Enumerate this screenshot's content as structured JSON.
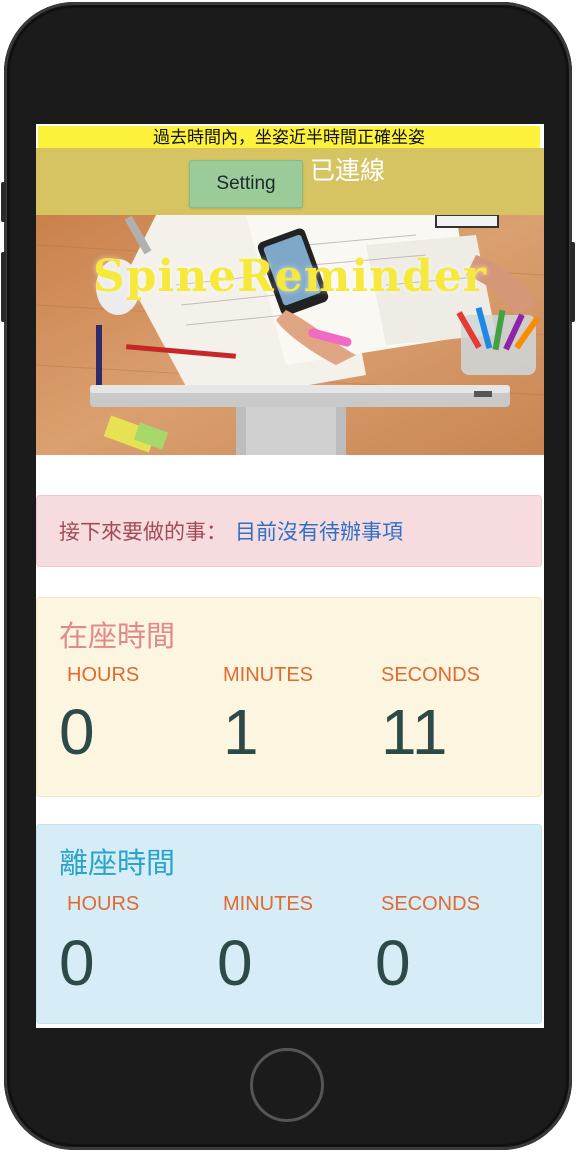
{
  "status_banner": "過去時間內，坐姿近半時間正確坐姿",
  "header": {
    "setting_label": "Setting",
    "connection_status": "已連線"
  },
  "hero": {
    "title": "SpineReminder"
  },
  "todo": {
    "label": "接下來要做的事：",
    "value": "目前沒有待辦事項"
  },
  "seated_timer": {
    "title": "在座時間",
    "units": [
      "HOURS",
      "MINUTES",
      "SECONDS"
    ],
    "values": [
      "0",
      "1",
      "11"
    ]
  },
  "away_timer": {
    "title": "離座時間",
    "units": [
      "HOURS",
      "MINUTES",
      "SECONDS"
    ],
    "values": [
      "0",
      "0",
      "0"
    ]
  },
  "colors": {
    "banner": "#fcf13b",
    "topbar": "#d6c462",
    "setting_button": "#9bcb99",
    "todo_bg": "#f6dcde",
    "seated_bg": "#fcf5df",
    "away_bg": "#d6edf7",
    "unit_text": "#e06a30",
    "number_text": "#2c4a48"
  }
}
